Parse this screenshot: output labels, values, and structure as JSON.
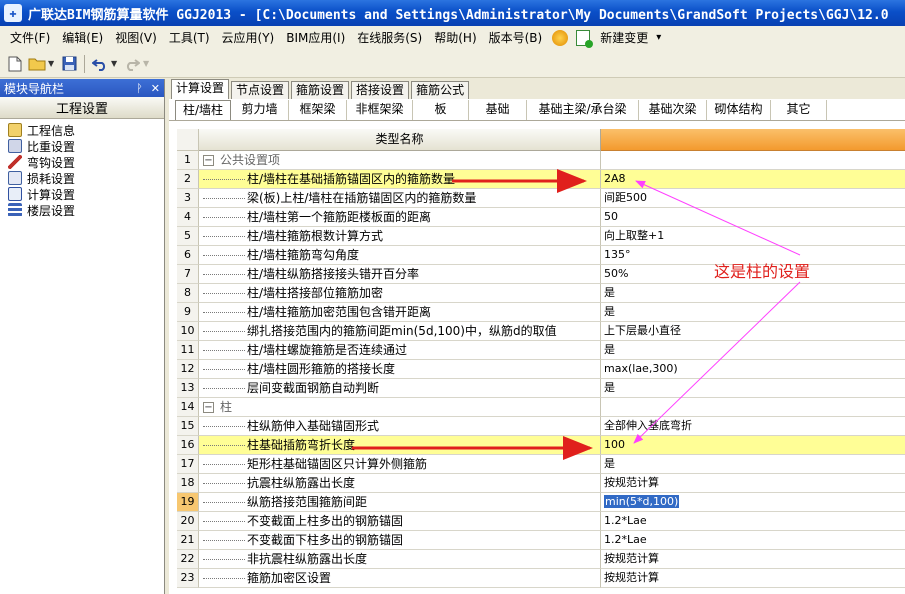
{
  "window": {
    "title": "广联达BIM钢筋算量软件 GGJ2013 - [C:\\Documents and Settings\\Administrator\\My Documents\\GrandSoft Projects\\GGJ\\12.0"
  },
  "menu": {
    "items": [
      "文件(F)",
      "编辑(E)",
      "视图(V)",
      "工具(T)",
      "云应用(Y)",
      "BIM应用(I)",
      "在线服务(S)",
      "帮助(H)",
      "版本号(B)"
    ],
    "new_change": "新建变更",
    "dropdown_glyph": "▾"
  },
  "nav": {
    "title": "模块导航栏",
    "pin_glyph": "ᚹ",
    "close_glyph": "✕",
    "header": "工程设置",
    "items": [
      "工程信息",
      "比重设置",
      "弯钩设置",
      "损耗设置",
      "计算设置",
      "楼层设置"
    ]
  },
  "tabs": [
    "计算设置",
    "节点设置",
    "箍筋设置",
    "搭接设置",
    "箍筋公式"
  ],
  "subtabs": [
    "柱/墙柱",
    "剪力墙",
    "框架梁",
    "非框架梁",
    "板",
    "基础",
    "基础主梁/承台梁",
    "基础次梁",
    "砌体结构",
    "其它"
  ],
  "grid": {
    "header": "类型名称",
    "rows": [
      {
        "n": "1",
        "name": "公共设置项",
        "value": "",
        "group": true,
        "expander": "−"
      },
      {
        "n": "2",
        "name": "柱/墙柱在基础插筋锚固区内的箍筋数量",
        "value": "2A8",
        "hl": true
      },
      {
        "n": "3",
        "name": "梁(板)上柱/墙柱在插筋锚固区内的箍筋数量",
        "value": "间距500"
      },
      {
        "n": "4",
        "name": "柱/墙柱第一个箍筋距楼板面的距离",
        "value": "50"
      },
      {
        "n": "5",
        "name": "柱/墙柱箍筋根数计算方式",
        "value": "向上取整+1"
      },
      {
        "n": "6",
        "name": "柱/墙柱箍筋弯勾角度",
        "value": "135°"
      },
      {
        "n": "7",
        "name": "柱/墙柱纵筋搭接接头错开百分率",
        "value": "50%"
      },
      {
        "n": "8",
        "name": "柱/墙柱搭接部位箍筋加密",
        "value": "是"
      },
      {
        "n": "9",
        "name": "柱/墙柱箍筋加密范围包含错开距离",
        "value": "是"
      },
      {
        "n": "10",
        "name": "绑扎搭接范围内的箍筋间距min(5d,100)中，纵筋d的取值",
        "value": "上下层最小直径"
      },
      {
        "n": "11",
        "name": "柱/墙柱螺旋箍筋是否连续通过",
        "value": "是"
      },
      {
        "n": "12",
        "name": "柱/墙柱圆形箍筋的搭接长度",
        "value": "max(lae,300)"
      },
      {
        "n": "13",
        "name": "层间变截面钢筋自动判断",
        "value": "是"
      },
      {
        "n": "14",
        "name": "柱",
        "value": "",
        "group": true,
        "expander": "−"
      },
      {
        "n": "15",
        "name": "柱纵筋伸入基础锚固形式",
        "value": "全部伸入基底弯折"
      },
      {
        "n": "16",
        "name": "柱基础插筋弯折长度",
        "value": "100",
        "hl": true
      },
      {
        "n": "17",
        "name": "矩形柱基础锚固区只计算外侧箍筋",
        "value": "是"
      },
      {
        "n": "18",
        "name": "抗震柱纵筋露出长度",
        "value": "按规范计算"
      },
      {
        "n": "19",
        "name": "纵筋搭接范围箍筋间距",
        "value": "min(5*d,100)",
        "selected": true
      },
      {
        "n": "20",
        "name": "不变截面上柱多出的钢筋锚固",
        "value": "1.2*Lae"
      },
      {
        "n": "21",
        "name": "不变截面下柱多出的钢筋锚固",
        "value": "1.2*Lae"
      },
      {
        "n": "22",
        "name": "非抗震柱纵筋露出长度",
        "value": "按规范计算"
      },
      {
        "n": "23",
        "name": "箍筋加密区设置",
        "value": "按规范计算"
      }
    ]
  },
  "annotation": {
    "text": "这是柱的设置",
    "color": "#e0201c",
    "line_color": "#ff40ff"
  }
}
